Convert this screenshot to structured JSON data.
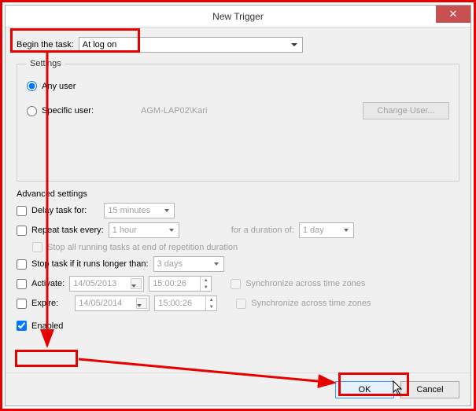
{
  "titlebar": {
    "title": "New Trigger",
    "close": "✕"
  },
  "begin": {
    "label": "Begin the task:",
    "value": "At log on"
  },
  "settings": {
    "legend": "Settings",
    "any_user": "Any user",
    "specific_user": "Specific user:",
    "user_value": "AGM-LAP02\\Kari",
    "change_user": "Change User..."
  },
  "advanced": {
    "heading": "Advanced settings",
    "delay_label": "Delay task for:",
    "delay_value": "15 minutes",
    "repeat_label": "Repeat task every:",
    "repeat_value": "1 hour",
    "duration_label": "for a duration of:",
    "duration_value": "1 day",
    "stop_all": "Stop all running tasks at end of repetition duration",
    "stop_if_label": "Stop task if it runs longer than:",
    "stop_if_value": "3 days",
    "activate_label": "Activate:",
    "activate_date": "14/05/2013",
    "activate_time": "15:00:26",
    "expire_label": "Expire:",
    "expire_date": "14/05/2014",
    "expire_time": "15:00:26",
    "sync": "Synchronize across time zones",
    "enabled": "Enabled"
  },
  "footer": {
    "ok": "OK",
    "cancel": "Cancel"
  }
}
